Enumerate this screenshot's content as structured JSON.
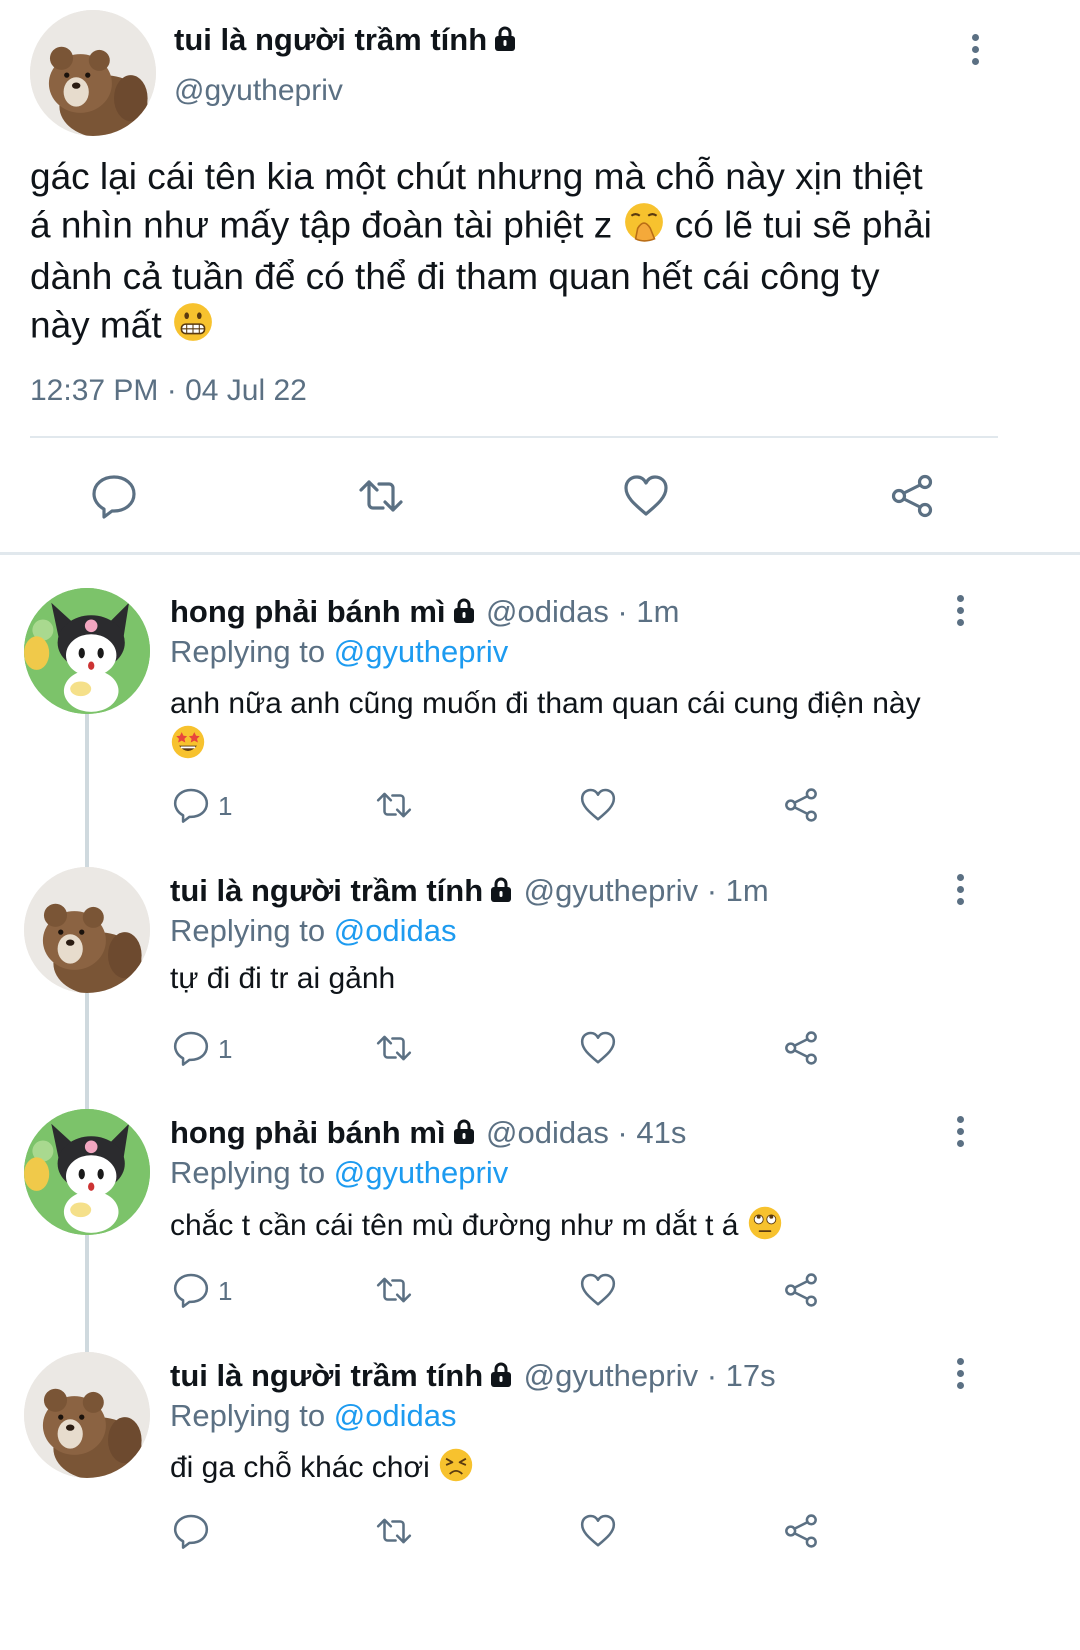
{
  "main_tweet": {
    "name": "tui là người trầm tính",
    "handle": "@gyuthepriv",
    "text_line1": "gác lại cái tên kia một chút nhưng mà chỗ này xịn thiệt",
    "text_line2a": "á nhìn như mấy tập đoàn tài phiệt z",
    "text_line2b": "có lẽ tui sẽ phải",
    "text_line3": "dành cả tuần để có thể đi tham quan hết cái công ty",
    "text_line4": "này mất",
    "timestamp": "12:37 PM · 04 Jul 22"
  },
  "replies": [
    {
      "name": "hong phải bánh mì",
      "handle_time": "@odidas · 1m",
      "replying_label": "Replying to",
      "replying_to": "@gyuthepriv",
      "text": "anh nữa anh cũng muốn đi tham quan cái cung điện này",
      "reply_count": "1",
      "avatar": "kuromi-avatar"
    },
    {
      "name": "tui là người trầm tính",
      "handle_time": "@gyuthepriv · 1m",
      "replying_label": "Replying to",
      "replying_to": "@odidas",
      "text": "tự đi đi tr ai gảnh",
      "reply_count": "1",
      "avatar": "bear-avatar"
    },
    {
      "name": "hong phải bánh mì",
      "handle_time": "@odidas · 41s",
      "replying_label": "Replying to",
      "replying_to": "@gyuthepriv",
      "text": "chắc t cần cái tên mù đường như m dắt t á",
      "reply_count": "1",
      "avatar": "kuromi-avatar"
    },
    {
      "name": "tui là người trầm tính",
      "handle_time": "@gyuthepriv · 17s",
      "replying_label": "Replying to",
      "replying_to": "@odidas",
      "text": "đi ga chỗ khác chơi",
      "reply_count": "",
      "avatar": "bear-avatar"
    }
  ],
  "colors": {
    "text": "#0f1419",
    "secondary": "#5b7083",
    "link": "#1d9bf0",
    "divider": "#e1e8ed"
  }
}
